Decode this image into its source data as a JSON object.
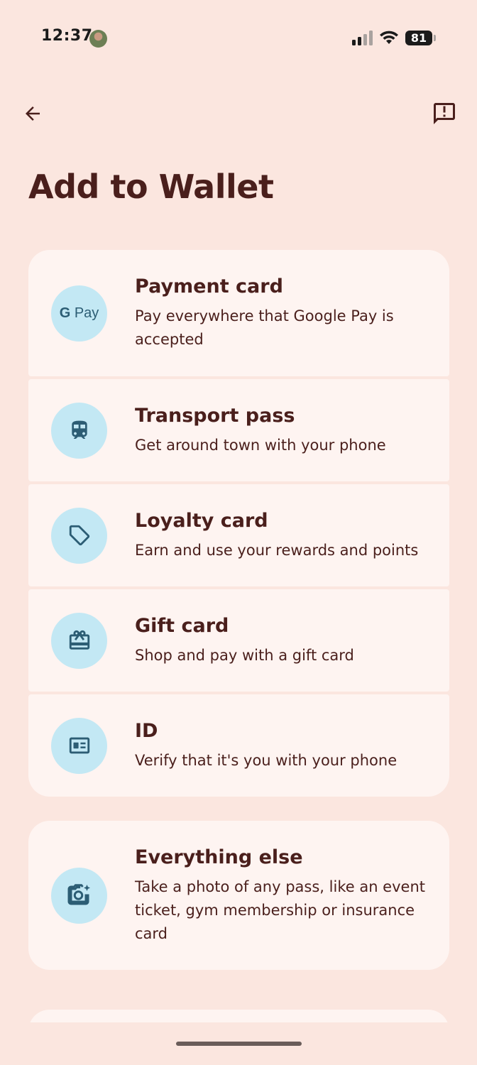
{
  "status_bar": {
    "time": "12:37",
    "battery": "81"
  },
  "header": {
    "back_icon": "arrow-back-icon",
    "feedback_icon": "feedback-icon"
  },
  "page": {
    "title": "Add to Wallet"
  },
  "cards": [
    {
      "id": "payment",
      "title": "Payment card",
      "description": "Pay everywhere that Google Pay is accepted",
      "icon": "google-pay-icon",
      "icon_text_g": "G",
      "icon_text_pay": "Pay"
    },
    {
      "id": "transport",
      "title": "Transport pass",
      "description": "Get around town with your phone",
      "icon": "train-icon"
    },
    {
      "id": "loyalty",
      "title": "Loyalty card",
      "description": "Earn and use your rewards and points",
      "icon": "tag-heart-icon"
    },
    {
      "id": "gift",
      "title": "Gift card",
      "description": "Shop and pay with a gift card",
      "icon": "gift-card-icon"
    },
    {
      "id": "id",
      "title": "ID",
      "description": "Verify that it's you with your phone",
      "icon": "id-card-icon"
    }
  ],
  "everything_else": {
    "title": "Everything else",
    "description": "Take a photo of any pass, like an event ticket, gym membership or insurance card",
    "icon": "camera-sparkle-icon"
  },
  "colors": {
    "background": "#fbe6df",
    "card": "#fef4f1",
    "icon_circle": "#c3e8f4",
    "icon_fg": "#2c5d74",
    "text": "#4a1f1c"
  }
}
